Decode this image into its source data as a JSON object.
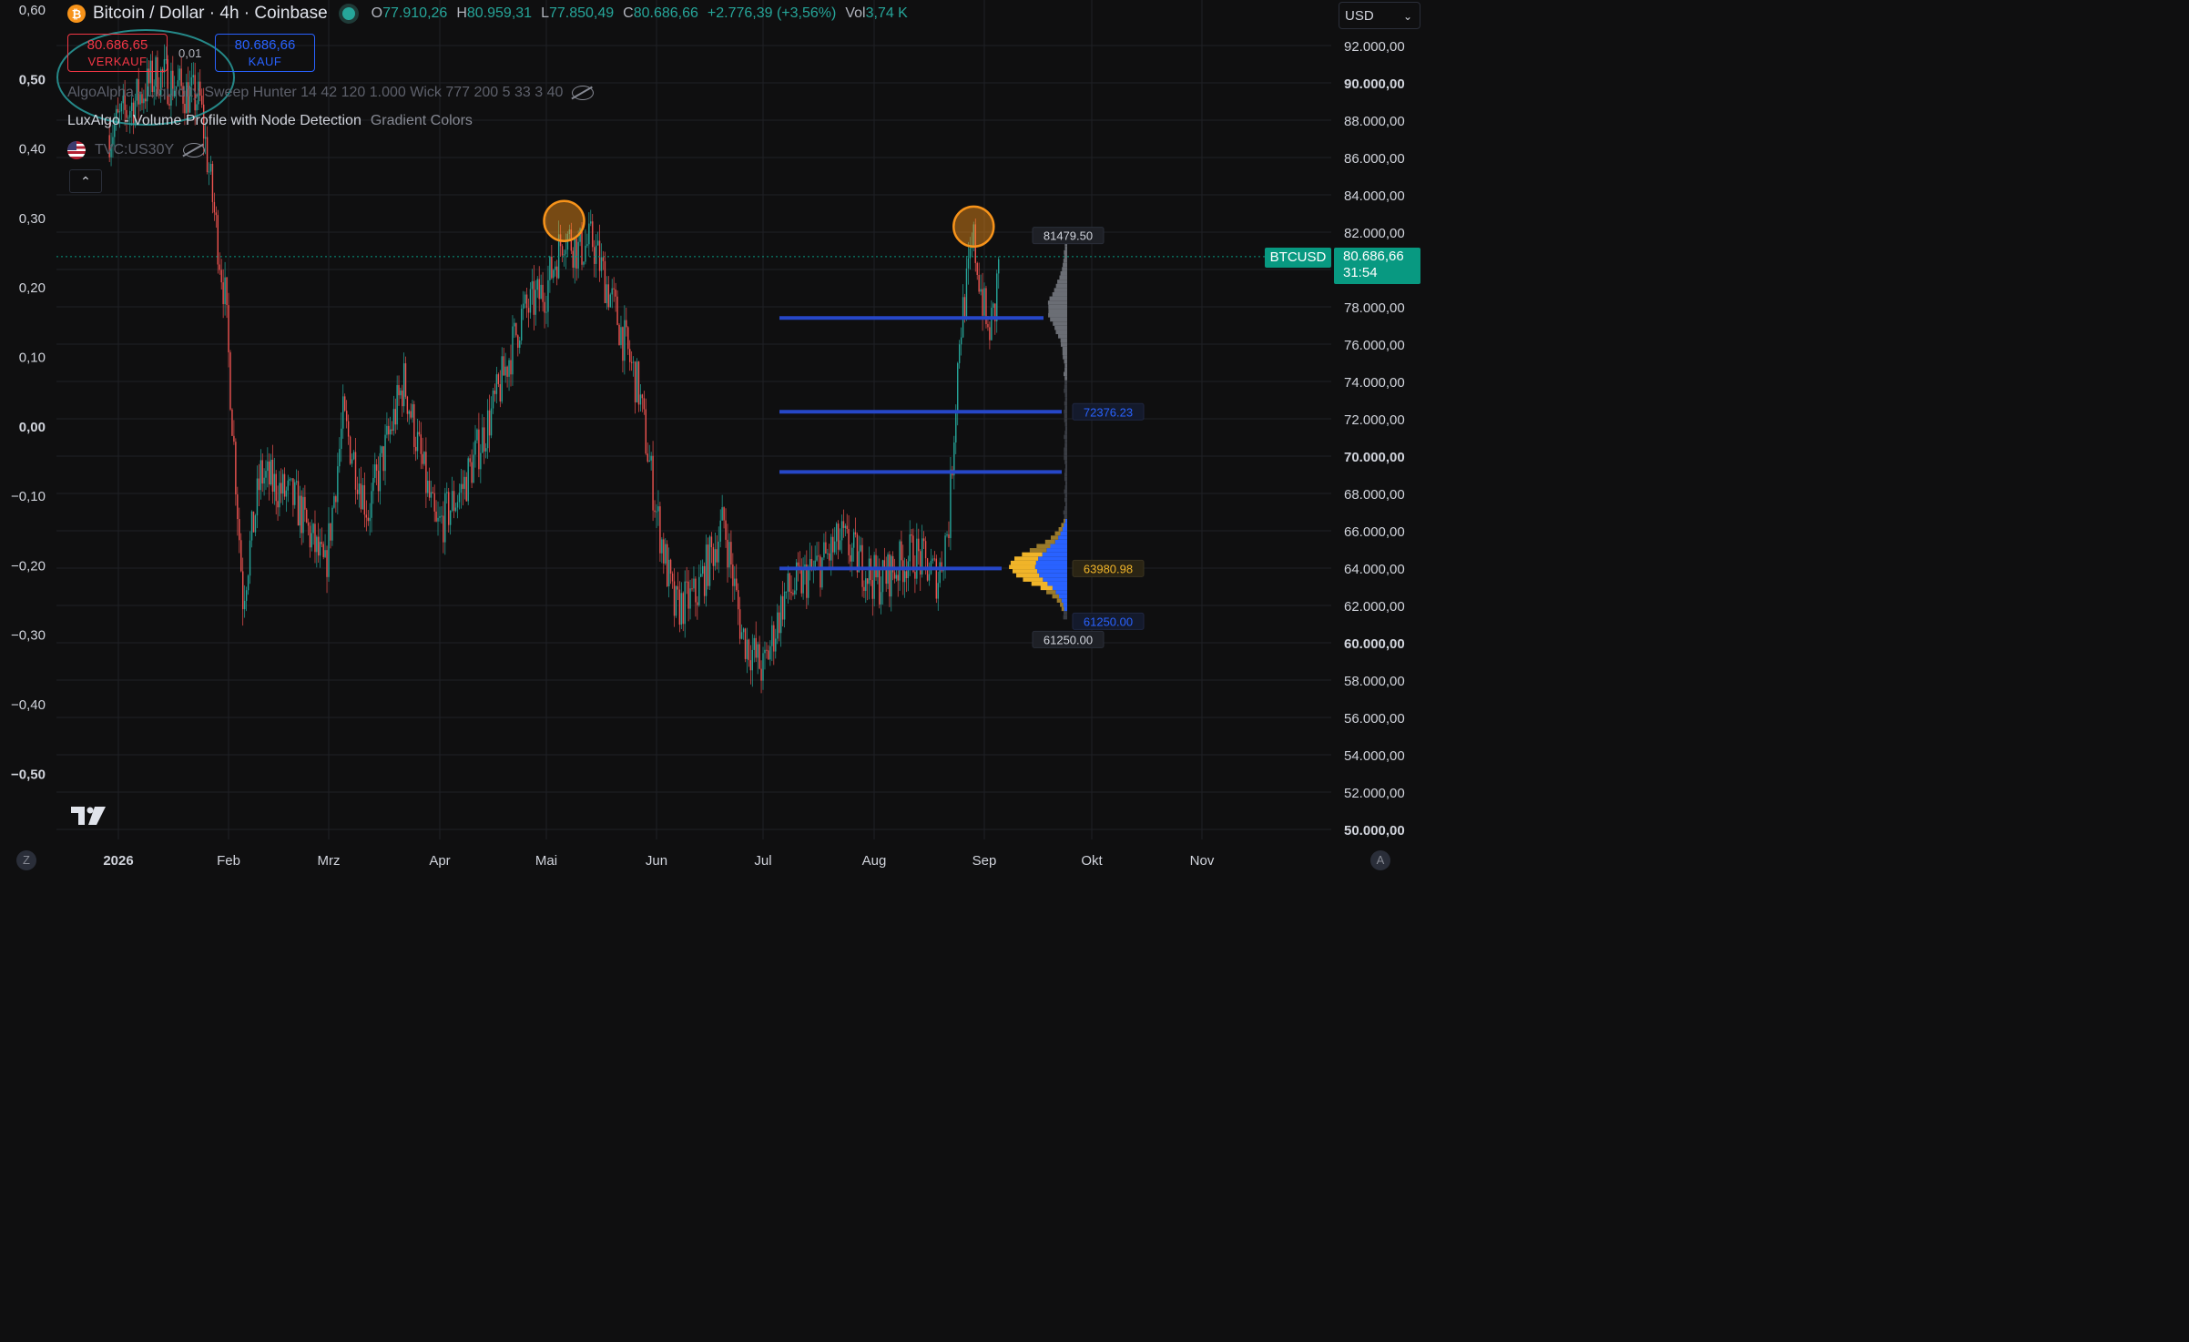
{
  "header": {
    "title": "Bitcoin / Dollar · 4h · Coinbase",
    "ohlc": [
      {
        "k": "O",
        "v": "77.910,26"
      },
      {
        "k": "H",
        "v": "80.959,31"
      },
      {
        "k": "L",
        "v": "77.850,49"
      },
      {
        "k": "C",
        "v": "80.686,66"
      }
    ],
    "change": "+2.776,39 (+3,56%)",
    "vol_label": "Vol",
    "vol_value": "3,74 K"
  },
  "trade": {
    "sell_price": "80.686,65",
    "sell_label": "VERKAUF",
    "buy_price": "80.686,66",
    "buy_label": "KAUF",
    "spread": "0,01"
  },
  "indicators": [
    {
      "name": "AlgoAlpha - Liquidity Sweep Hunter 14 42 120 1.000 Wick 777 200 5 33 3 40",
      "hidden": true
    },
    {
      "name": "LuxAlgo - Volume Profile with Node Detection",
      "sub": "Gradient Colors"
    },
    {
      "name": "TVC:US30Y",
      "hidden": true
    }
  ],
  "collapse_glyph": "⌃",
  "currency": "USD",
  "current_price": {
    "symbol": "BTCUSD",
    "value": "80.686,66",
    "countdown": "31:54"
  },
  "profile_labels": {
    "poc": "63980.98",
    "node": "72376.23",
    "low_blue": "61250.00",
    "range_high": "81479.50",
    "range_low": "61250.00"
  },
  "corner_left": "Z",
  "corner_right": "A",
  "colors": {
    "up": "#26a69a",
    "down": "#ef5350",
    "level": "#2647c8",
    "poc": "#f0b429",
    "profile_blue": "#2962ff",
    "circle": "#f7931a",
    "tag": "#089981"
  },
  "chart_data": {
    "type": "candlestick",
    "title": "Bitcoin / Dollar · 4h · Coinbase",
    "y_right": {
      "ticks": [
        "92.000,00",
        "90.000,00",
        "88.000,00",
        "86.000,00",
        "84.000,00",
        "82.000,00",
        "78.000,00",
        "76.000,00",
        "74.000,00",
        "72.000,00",
        "70.000,00",
        "68.000,00",
        "66.000,00",
        "64.000,00",
        "62.000,00",
        "60.000,00",
        "58.000,00",
        "56.000,00",
        "54.000,00",
        "52.000,00",
        "50.000,00"
      ],
      "tick_values": [
        92000,
        90000,
        88000,
        86000,
        84000,
        82000,
        78000,
        76000,
        74000,
        72000,
        70000,
        68000,
        66000,
        64000,
        62000,
        60000,
        58000,
        56000,
        54000,
        52000,
        50000
      ],
      "bold": [
        "90.000,00",
        "70.000,00",
        "60.000,00",
        "50.000,00"
      ],
      "range": [
        49500,
        92800
      ]
    },
    "y_left": {
      "ticks": [
        "0,60",
        "0,50",
        "0,40",
        "0,30",
        "0,20",
        "0,10",
        "0,00",
        "−0,10",
        "−0,20",
        "−0,30",
        "−0,40",
        "−0,50"
      ],
      "tick_values": [
        0.6,
        0.5,
        0.4,
        0.3,
        0.2,
        0.1,
        0.0,
        -0.1,
        -0.2,
        -0.3,
        -0.4,
        -0.5
      ],
      "bold": [
        "0,50",
        "0,00",
        "−0,50"
      ]
    },
    "x_axis": {
      "ticks": [
        "2026",
        "Feb",
        "Mrz",
        "Apr",
        "Mai",
        "Jun",
        "Jul",
        "Aug",
        "Sep",
        "Okt",
        "Nov"
      ],
      "bold": [
        "2026"
      ]
    },
    "price_path": [
      [
        "Dec 29",
        87200
      ],
      [
        "Jan 12",
        90500
      ],
      [
        "Jan 24",
        89000
      ],
      [
        "Jan 31",
        78500
      ],
      [
        "Feb 05",
        62500
      ],
      [
        "Feb 10",
        69000
      ],
      [
        "Feb 20",
        67500
      ],
      [
        "Feb 28",
        63800
      ],
      [
        "Mrz 05",
        72000
      ],
      [
        "Mrz 12",
        67000
      ],
      [
        "Mrz 22",
        74000
      ],
      [
        "Mrz 31",
        66000
      ],
      [
        "Apr 08",
        68500
      ],
      [
        "Apr 16",
        72500
      ],
      [
        "Apr 24",
        77500
      ],
      [
        "Mai 01",
        79000
      ],
      [
        "Mai 06",
        82000
      ],
      [
        "Mai 10",
        81000
      ],
      [
        "Mai 14",
        81500
      ],
      [
        "Mai 20",
        78000
      ],
      [
        "Mai 27",
        73500
      ],
      [
        "Jun 01",
        67000
      ],
      [
        "Jun 06",
        61800
      ],
      [
        "Jun 12",
        62500
      ],
      [
        "Jun 20",
        66500
      ],
      [
        "Jun 25",
        60500
      ],
      [
        "Jul 01",
        58500
      ],
      [
        "Jul 07",
        62500
      ],
      [
        "Jul 16",
        64000
      ],
      [
        "Jul 23",
        65500
      ],
      [
        "Aug 02",
        63200
      ],
      [
        "Aug 12",
        64800
      ],
      [
        "Aug 19",
        63500
      ],
      [
        "Aug 22",
        66500
      ],
      [
        "Aug 25",
        76500
      ],
      [
        "Aug 29",
        81500
      ],
      [
        "Sep 02",
        76500
      ],
      [
        "Sep 04",
        77800
      ],
      [
        "Sep 05",
        80700
      ]
    ],
    "levels": [
      77400,
      72376.23,
      69150,
      63980.98
    ],
    "highlight_circles": [
      [
        "Mai 06",
        82600
      ],
      [
        "Aug 29",
        82300
      ]
    ],
    "volume_profile": {
      "range_high": 81479.5,
      "range_low": 61250.0,
      "poc": 63980.98,
      "nodes": [
        72376.23,
        61250.0
      ]
    },
    "current_price": 80686.66
  }
}
